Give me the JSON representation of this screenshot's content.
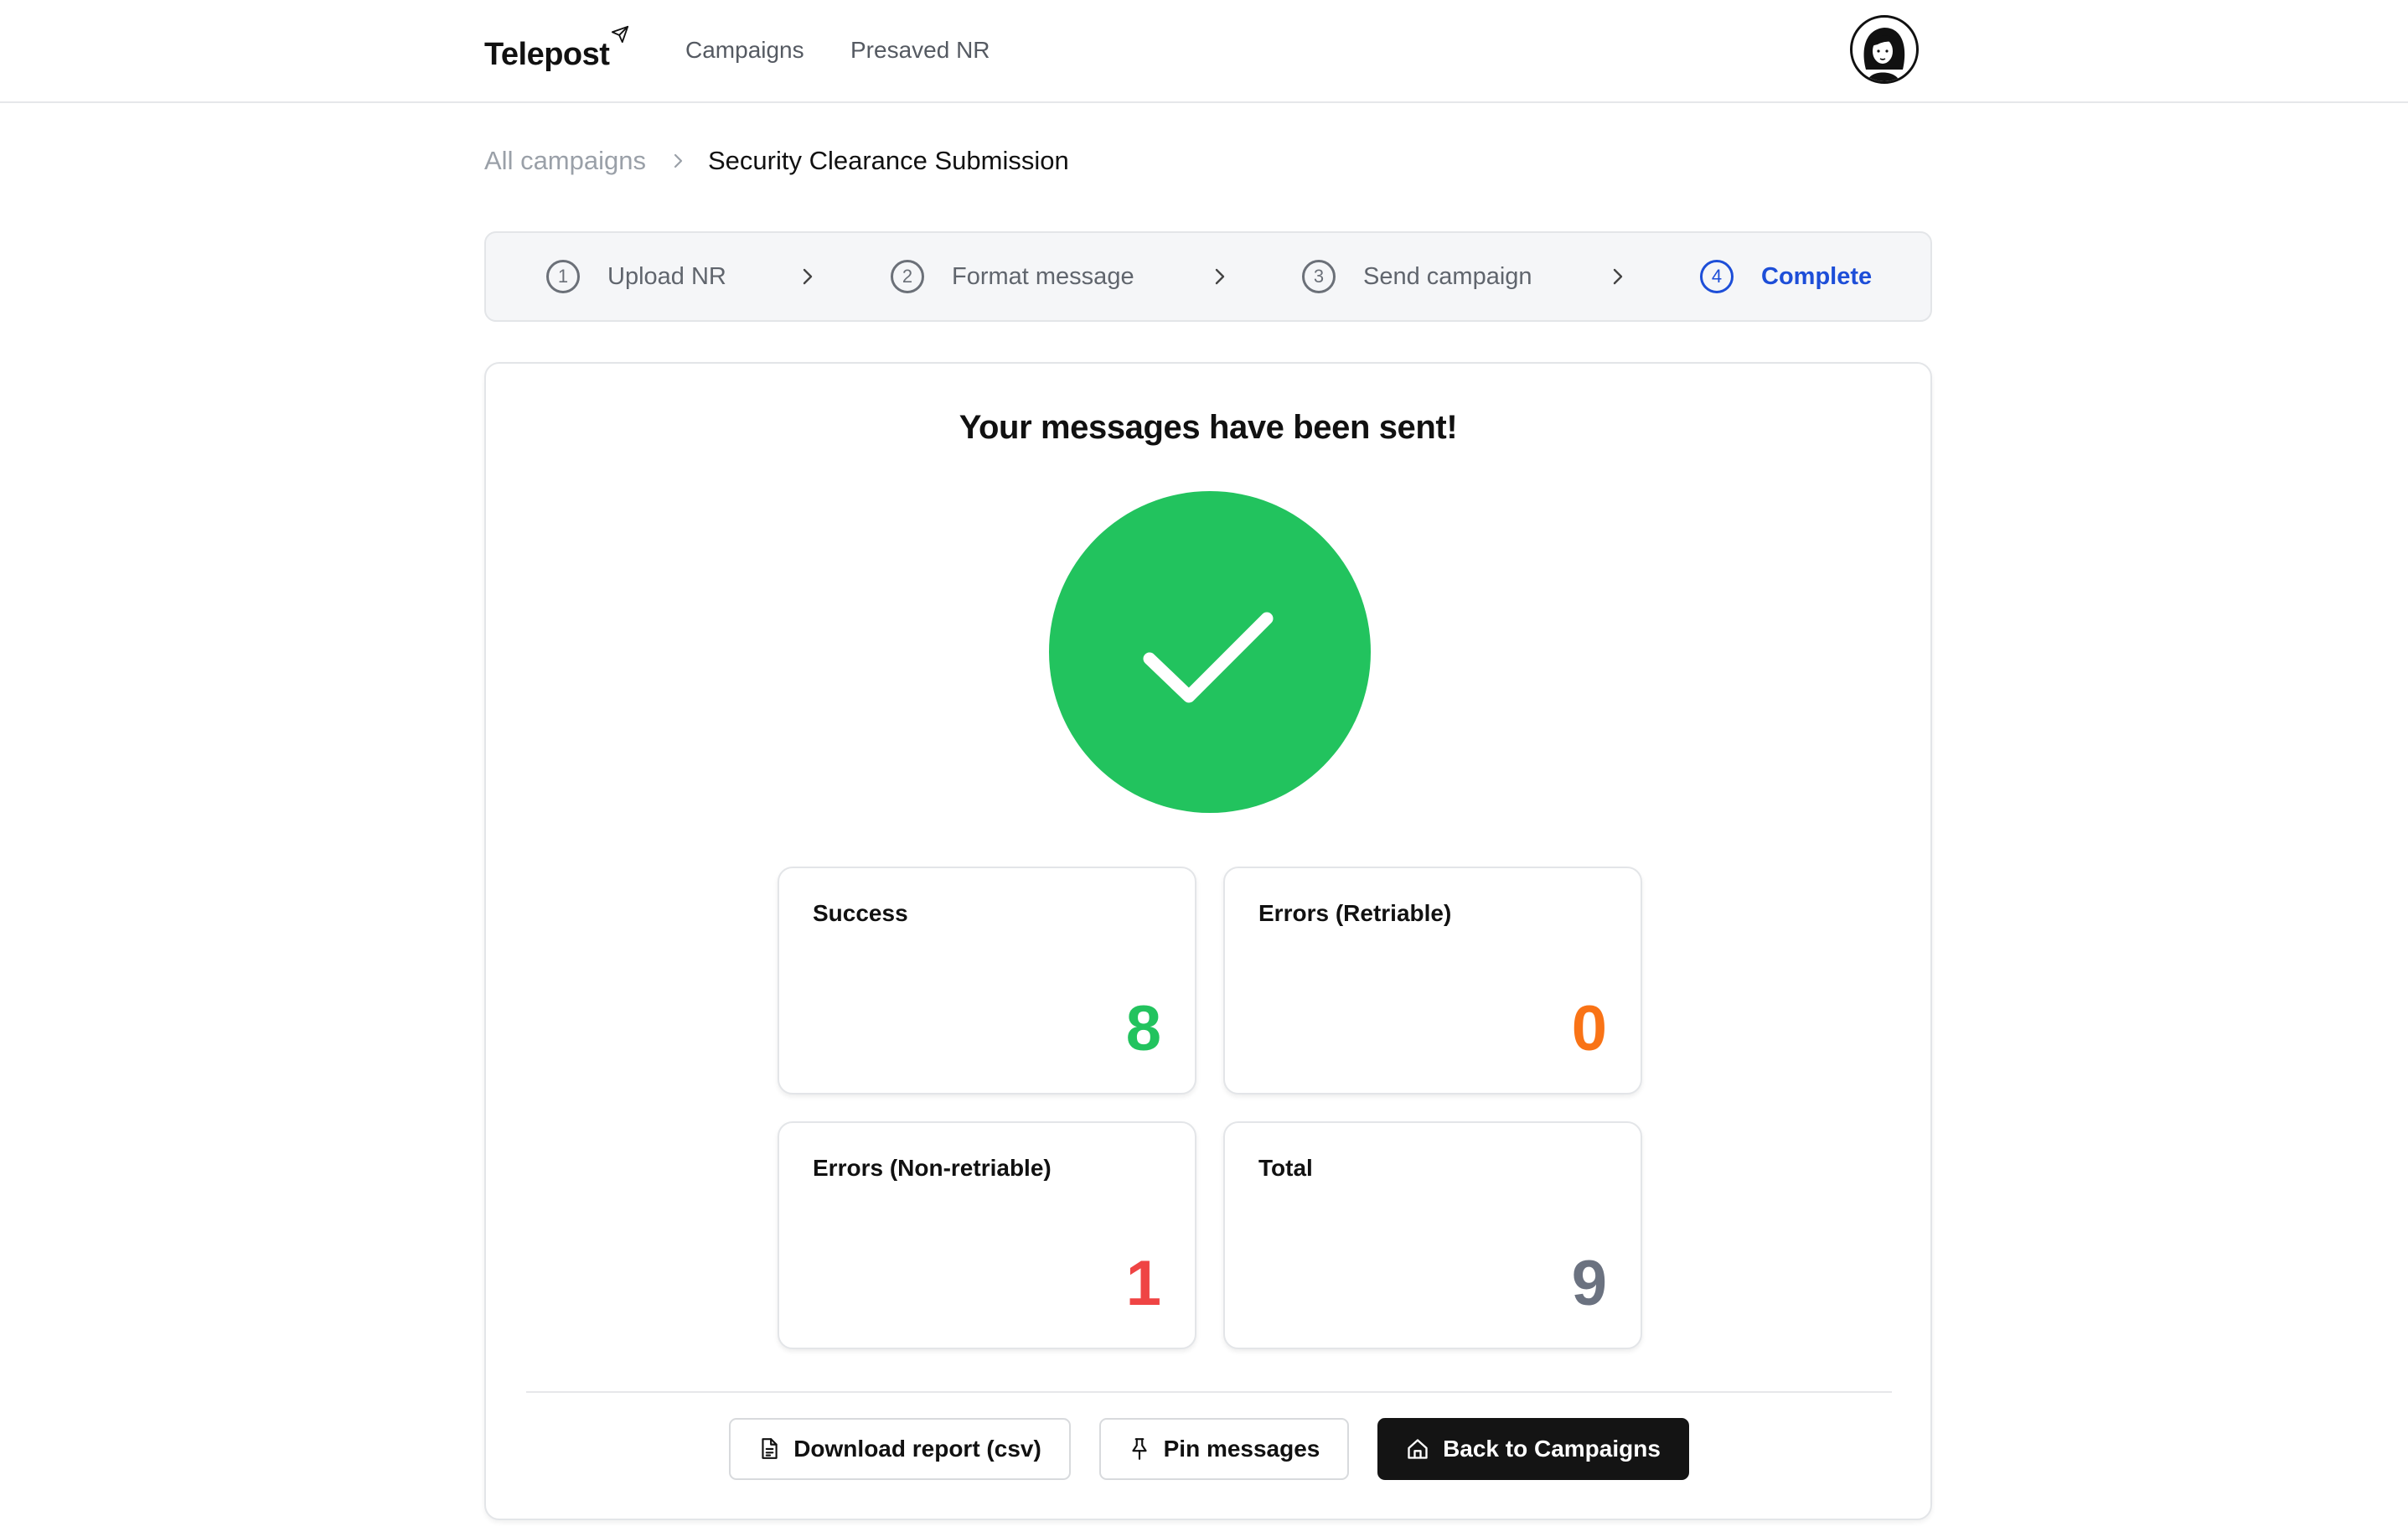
{
  "app": {
    "brand": "Telepost",
    "nav": [
      {
        "label": "Campaigns"
      },
      {
        "label": "Presaved NR"
      }
    ]
  },
  "breadcrumb": {
    "parent": "All campaigns",
    "current": "Security Clearance Submission"
  },
  "stepper": {
    "steps": [
      {
        "number": "1",
        "label": "Upload NR",
        "state": "done"
      },
      {
        "number": "2",
        "label": "Format message",
        "state": "done"
      },
      {
        "number": "3",
        "label": "Send campaign",
        "state": "done"
      },
      {
        "number": "4",
        "label": "Complete",
        "state": "active"
      }
    ]
  },
  "result": {
    "headline": "Your messages have been sent!",
    "stats": [
      {
        "label": "Success",
        "value": "8",
        "color": "#22c35e"
      },
      {
        "label": "Errors (Retriable)",
        "value": "0",
        "color": "#f97316"
      },
      {
        "label": "Errors (Non-retriable)",
        "value": "1",
        "color": "#ef4444"
      },
      {
        "label": "Total",
        "value": "9",
        "color": "#6b7280"
      }
    ]
  },
  "actions": {
    "download": "Download report (csv)",
    "pin": "Pin messages",
    "back": "Back to Campaigns"
  },
  "colors": {
    "accent": "#1d4ed8",
    "success": "#22c35e",
    "primary_button": "#141414"
  },
  "icons": {
    "brand": "paper-plane-icon",
    "check": "check-icon",
    "download": "file-text-icon",
    "pin": "pin-icon",
    "back": "home-icon"
  }
}
